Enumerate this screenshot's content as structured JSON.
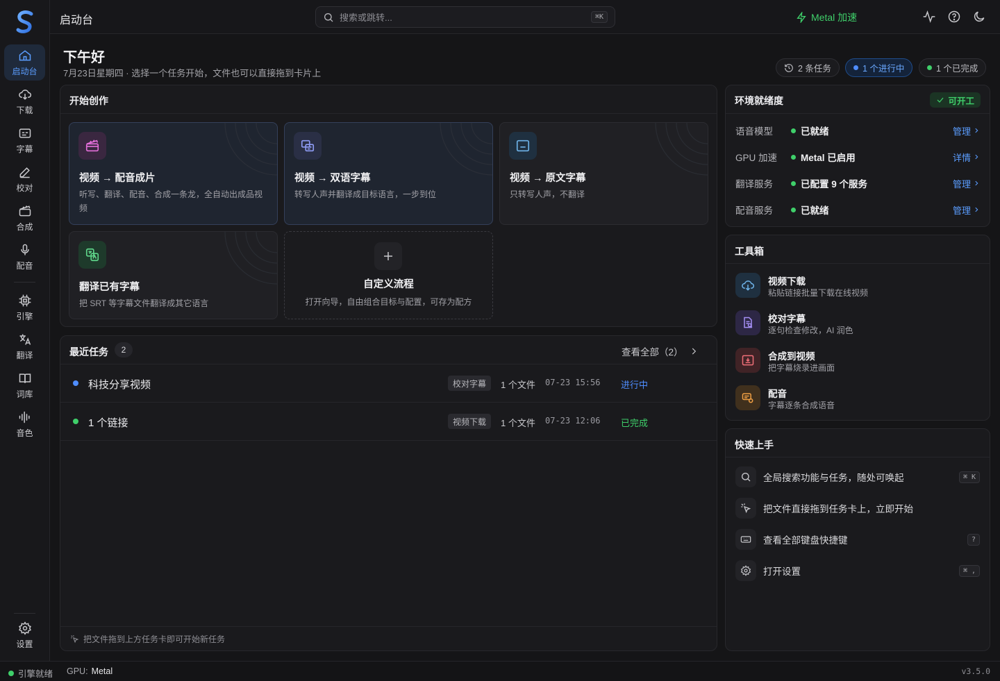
{
  "app": {
    "title": "启动台"
  },
  "sidebar": {
    "items": [
      {
        "label": "启动台",
        "icon": "home-icon",
        "active": true
      },
      {
        "label": "下载",
        "icon": "download-icon"
      },
      {
        "label": "字幕",
        "icon": "subtitles-icon"
      },
      {
        "label": "校对",
        "icon": "pen-icon"
      },
      {
        "label": "合成",
        "icon": "clapperboard-icon"
      },
      {
        "label": "配音",
        "icon": "microphone-icon"
      },
      {
        "label": "引擎",
        "icon": "chip-icon"
      },
      {
        "label": "翻译",
        "icon": "translate-icon"
      },
      {
        "label": "词库",
        "icon": "book-icon"
      },
      {
        "label": "音色",
        "icon": "waveform-icon"
      }
    ],
    "settings_label": "设置"
  },
  "topbar": {
    "search_placeholder": "搜索或跳转...",
    "search_shortcut": "⌘K",
    "metal_label": "Metal 加速"
  },
  "header": {
    "greeting": "下午好",
    "subline": "7月23日星期四 · 选择一个任务开始，文件也可以直接拖到卡片上",
    "pills": {
      "tasks": "2 条任务",
      "running": "1 个进行中",
      "done": "1 个已完成"
    }
  },
  "create": {
    "title": "开始创作",
    "cards": [
      {
        "title": "视频 → 配音成片",
        "desc": "听写、翻译、配音、合成一条龙，全自动出成品视频",
        "icon": "clapperboard-icon"
      },
      {
        "title": "视频 → 双语字幕",
        "desc": "转写人声并翻译成目标语言，一步到位",
        "icon": "bilingual-subtitle-icon"
      },
      {
        "title": "视频 → 原文字幕",
        "desc": "只转写人声，不翻译",
        "icon": "caption-icon"
      },
      {
        "title": "翻译已有字幕",
        "desc": "把 SRT 等字幕文件翻译成其它语言",
        "icon": "translate-icon"
      }
    ],
    "custom": {
      "title": "自定义流程",
      "desc": "打开向导，自由组合目标与配置，可存为配方"
    }
  },
  "recent": {
    "title": "最近任务",
    "count": "2",
    "view_all": "查看全部（2）",
    "tasks": [
      {
        "name": "科技分享视频",
        "tag": "校对字幕",
        "files": "1 个文件",
        "time": "07-23 15:56",
        "status": "进行中",
        "status_color": "#4f8dff"
      },
      {
        "name": "1 个链接",
        "tag": "视频下载",
        "files": "1 个文件",
        "time": "07-23 12:06",
        "status": "已完成",
        "status_color": "#3fcf6a"
      }
    ],
    "footer_hint": "把文件拖到上方任务卡即可开始新任务"
  },
  "env": {
    "title": "环境就绪度",
    "badge": "可开工",
    "rows": [
      {
        "label": "语音模型",
        "value": "已就绪",
        "link": "管理"
      },
      {
        "label": "GPU 加速",
        "value": "Metal 已启用",
        "link": "详情"
      },
      {
        "label": "翻译服务",
        "value": "已配置 9 个服务",
        "link": "管理"
      },
      {
        "label": "配音服务",
        "value": "已就绪",
        "link": "管理"
      }
    ]
  },
  "toolbox": {
    "title": "工具箱",
    "tools": [
      {
        "title": "视频下载",
        "desc": "粘贴链接批量下载在线视频",
        "icon": "download-cloud-icon"
      },
      {
        "title": "校对字幕",
        "desc": "逐句检查修改，AI 润色",
        "icon": "proofread-icon"
      },
      {
        "title": "合成到视频",
        "desc": "把字幕烧录进画面",
        "icon": "burn-in-icon"
      },
      {
        "title": "配音",
        "desc": "字幕逐条合成语音",
        "icon": "voice-icon"
      }
    ]
  },
  "quickstart": {
    "title": "快速上手",
    "items": [
      {
        "text": "全局搜索功能与任务，随处可唤起",
        "kbd": "⌘ K",
        "icon": "search-icon"
      },
      {
        "text": "把文件直接拖到任务卡上，立即开始",
        "kbd": "",
        "icon": "pointer-icon"
      },
      {
        "text": "查看全部键盘快捷键",
        "kbd": "?",
        "icon": "keyboard-icon"
      },
      {
        "text": "打开设置",
        "kbd": "⌘ ,",
        "icon": "gear-icon"
      }
    ]
  },
  "statusbar": {
    "engine": "引擎就绪",
    "gpu_label": "GPU:",
    "gpu_value": "Metal",
    "version": "v3.5.0"
  },
  "colors": {
    "accent": "#5b9dff",
    "green": "#3fcf6a",
    "bg": "#151517"
  }
}
